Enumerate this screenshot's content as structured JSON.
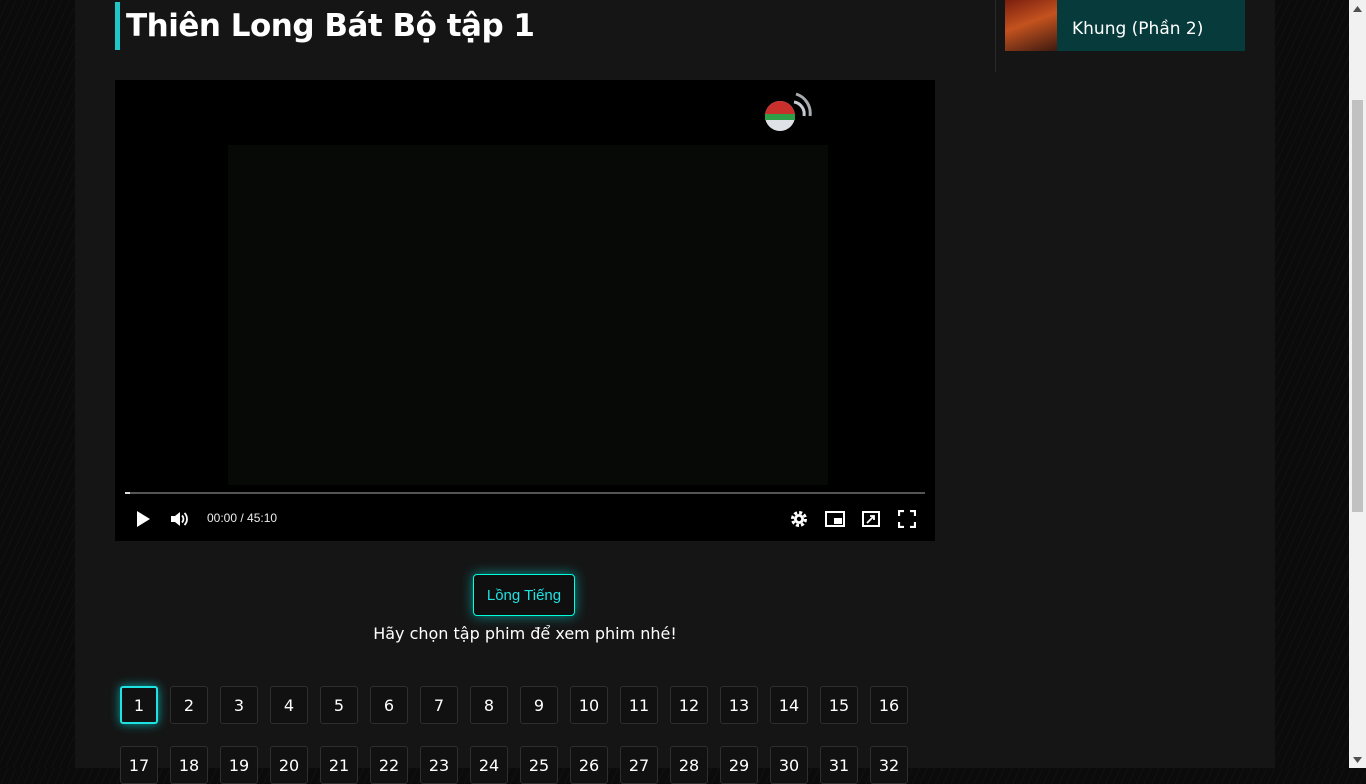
{
  "page": {
    "title": "Thiên Long Bát Bộ tập 1",
    "accent_color": "#1fc7c7"
  },
  "player": {
    "time_display": "00:00 / 45:10",
    "progress_fraction": 0.0,
    "icons": {
      "play": "play-icon",
      "volume": "volume-icon",
      "settings": "gear-icon",
      "pip": "picture-in-picture-icon",
      "theater": "theater-mode-icon",
      "fullscreen": "fullscreen-icon"
    }
  },
  "sidebar": {
    "recommended": {
      "title_visible": "Khung (Phần 2)"
    }
  },
  "language": {
    "button_label": "Lồng Tiếng"
  },
  "hint": "Hãy chọn tập phim để xem phim nhé!",
  "episodes": {
    "active": "1",
    "items": [
      "1",
      "2",
      "3",
      "4",
      "5",
      "6",
      "7",
      "8",
      "9",
      "10",
      "11",
      "12",
      "13",
      "14",
      "15",
      "16",
      "17",
      "18",
      "19",
      "20",
      "21",
      "22",
      "23",
      "24",
      "25",
      "26",
      "27",
      "28",
      "29",
      "30",
      "31",
      "32"
    ]
  }
}
